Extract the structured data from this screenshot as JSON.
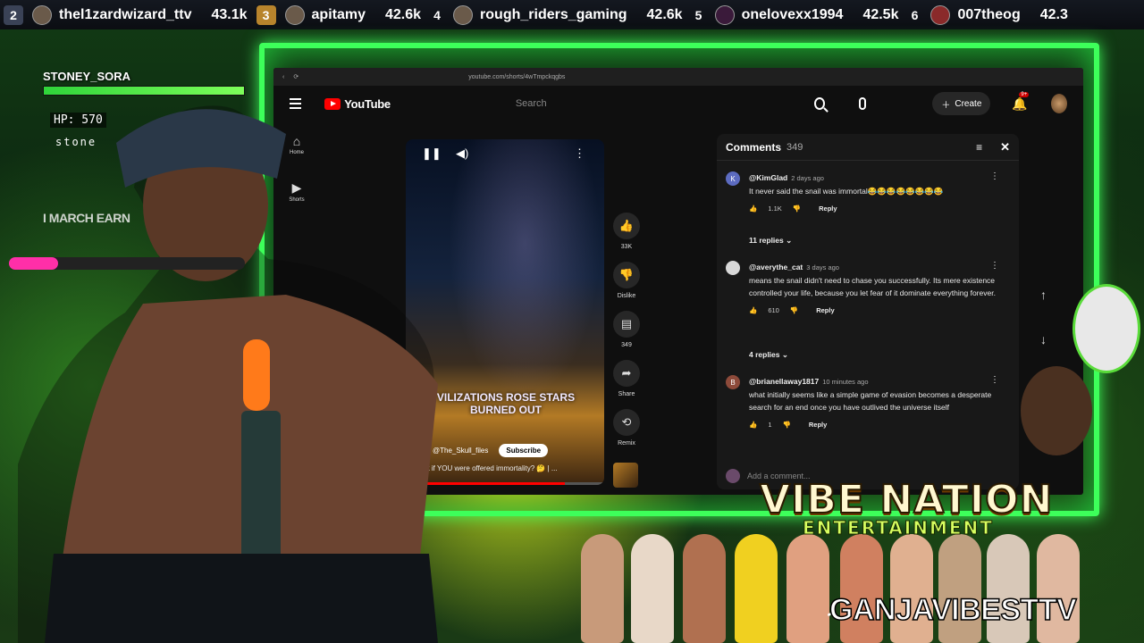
{
  "leaderboard": [
    {
      "rank": "2",
      "name": "thel1zardwizard_ttv",
      "score": "43.1k"
    },
    {
      "rank": "3",
      "name": "apitamy",
      "score": "42.6k"
    },
    {
      "rank": "4",
      "name": "rough_riders_gaming",
      "score": "42.6k"
    },
    {
      "rank": "5",
      "name": "onelovexx1994",
      "score": "42.5k"
    },
    {
      "rank": "6",
      "name": "007theog",
      "score": "42.3"
    }
  ],
  "streamer": {
    "name": "STONEY_SORA",
    "hp": "HP: 570",
    "tag": "stone",
    "march": "I MARCH EARN",
    "progress": 0.21
  },
  "browser": {
    "url": "youtube.com/shorts/4wTmpckqgbs",
    "brand": "YouTube",
    "search_placeholder": "Search",
    "create": "Create",
    "notif_badge": "9+",
    "sidebar": [
      {
        "label": "Home",
        "icon": "home-icon"
      },
      {
        "label": "Shorts",
        "icon": "shorts-icon"
      }
    ]
  },
  "short": {
    "caption": "VILIZATIONS ROSE STARS BURNED OUT",
    "channel": "@The_Skull_files",
    "subscribe": "Subscribe",
    "description": "What if YOU were offered immortality? 🤔 | ...",
    "progress": 0.8,
    "actions": [
      {
        "icon": "like-icon",
        "label": "33K"
      },
      {
        "icon": "dislike-icon",
        "label": "Dislike"
      },
      {
        "icon": "comment-icon",
        "label": "349"
      },
      {
        "icon": "share-icon",
        "label": "Share"
      },
      {
        "icon": "remix-icon",
        "label": "Remix"
      }
    ]
  },
  "comments": {
    "title": "Comments",
    "count": "349",
    "add_placeholder": "Add a comment...",
    "items": [
      {
        "avatar": "K",
        "avatar_color": "#5c6bc0",
        "author": "@KimGlad",
        "time": "2 days ago",
        "text": "It never said the snail was immortal😂😂😂😂😂😂😂😂",
        "likes": "1.1K",
        "reply": "Reply",
        "replies": "11 replies"
      },
      {
        "avatar": "",
        "avatar_color": "#d8d8d8",
        "author": "@averythe_cat",
        "time": "3 days ago",
        "text": "means the snail didn't need to chase you successfully. Its mere existence controlled your life, because you let fear of it dominate everything forever.",
        "likes": "610",
        "reply": "Reply",
        "replies": "4 replies"
      },
      {
        "avatar": "B",
        "avatar_color": "#8d4a3a",
        "author": "@brianellaway1817",
        "time": "10 minutes ago",
        "text": "what initially seems like a simple game of evasion becomes a desperate search for an end once you have outlived the universe itself",
        "likes": "1",
        "reply": "Reply",
        "replies": ""
      }
    ]
  },
  "branding": {
    "vibe": "VIBE NATION",
    "entertainment": "ENTERTAINMENT",
    "ganja": "GANJAVIBESTTV"
  },
  "colors": {
    "neon_green": "#3dff5a",
    "yt_red": "#ff0000",
    "health": "#2fd43a",
    "pink_bar": "#ff2fa8"
  }
}
